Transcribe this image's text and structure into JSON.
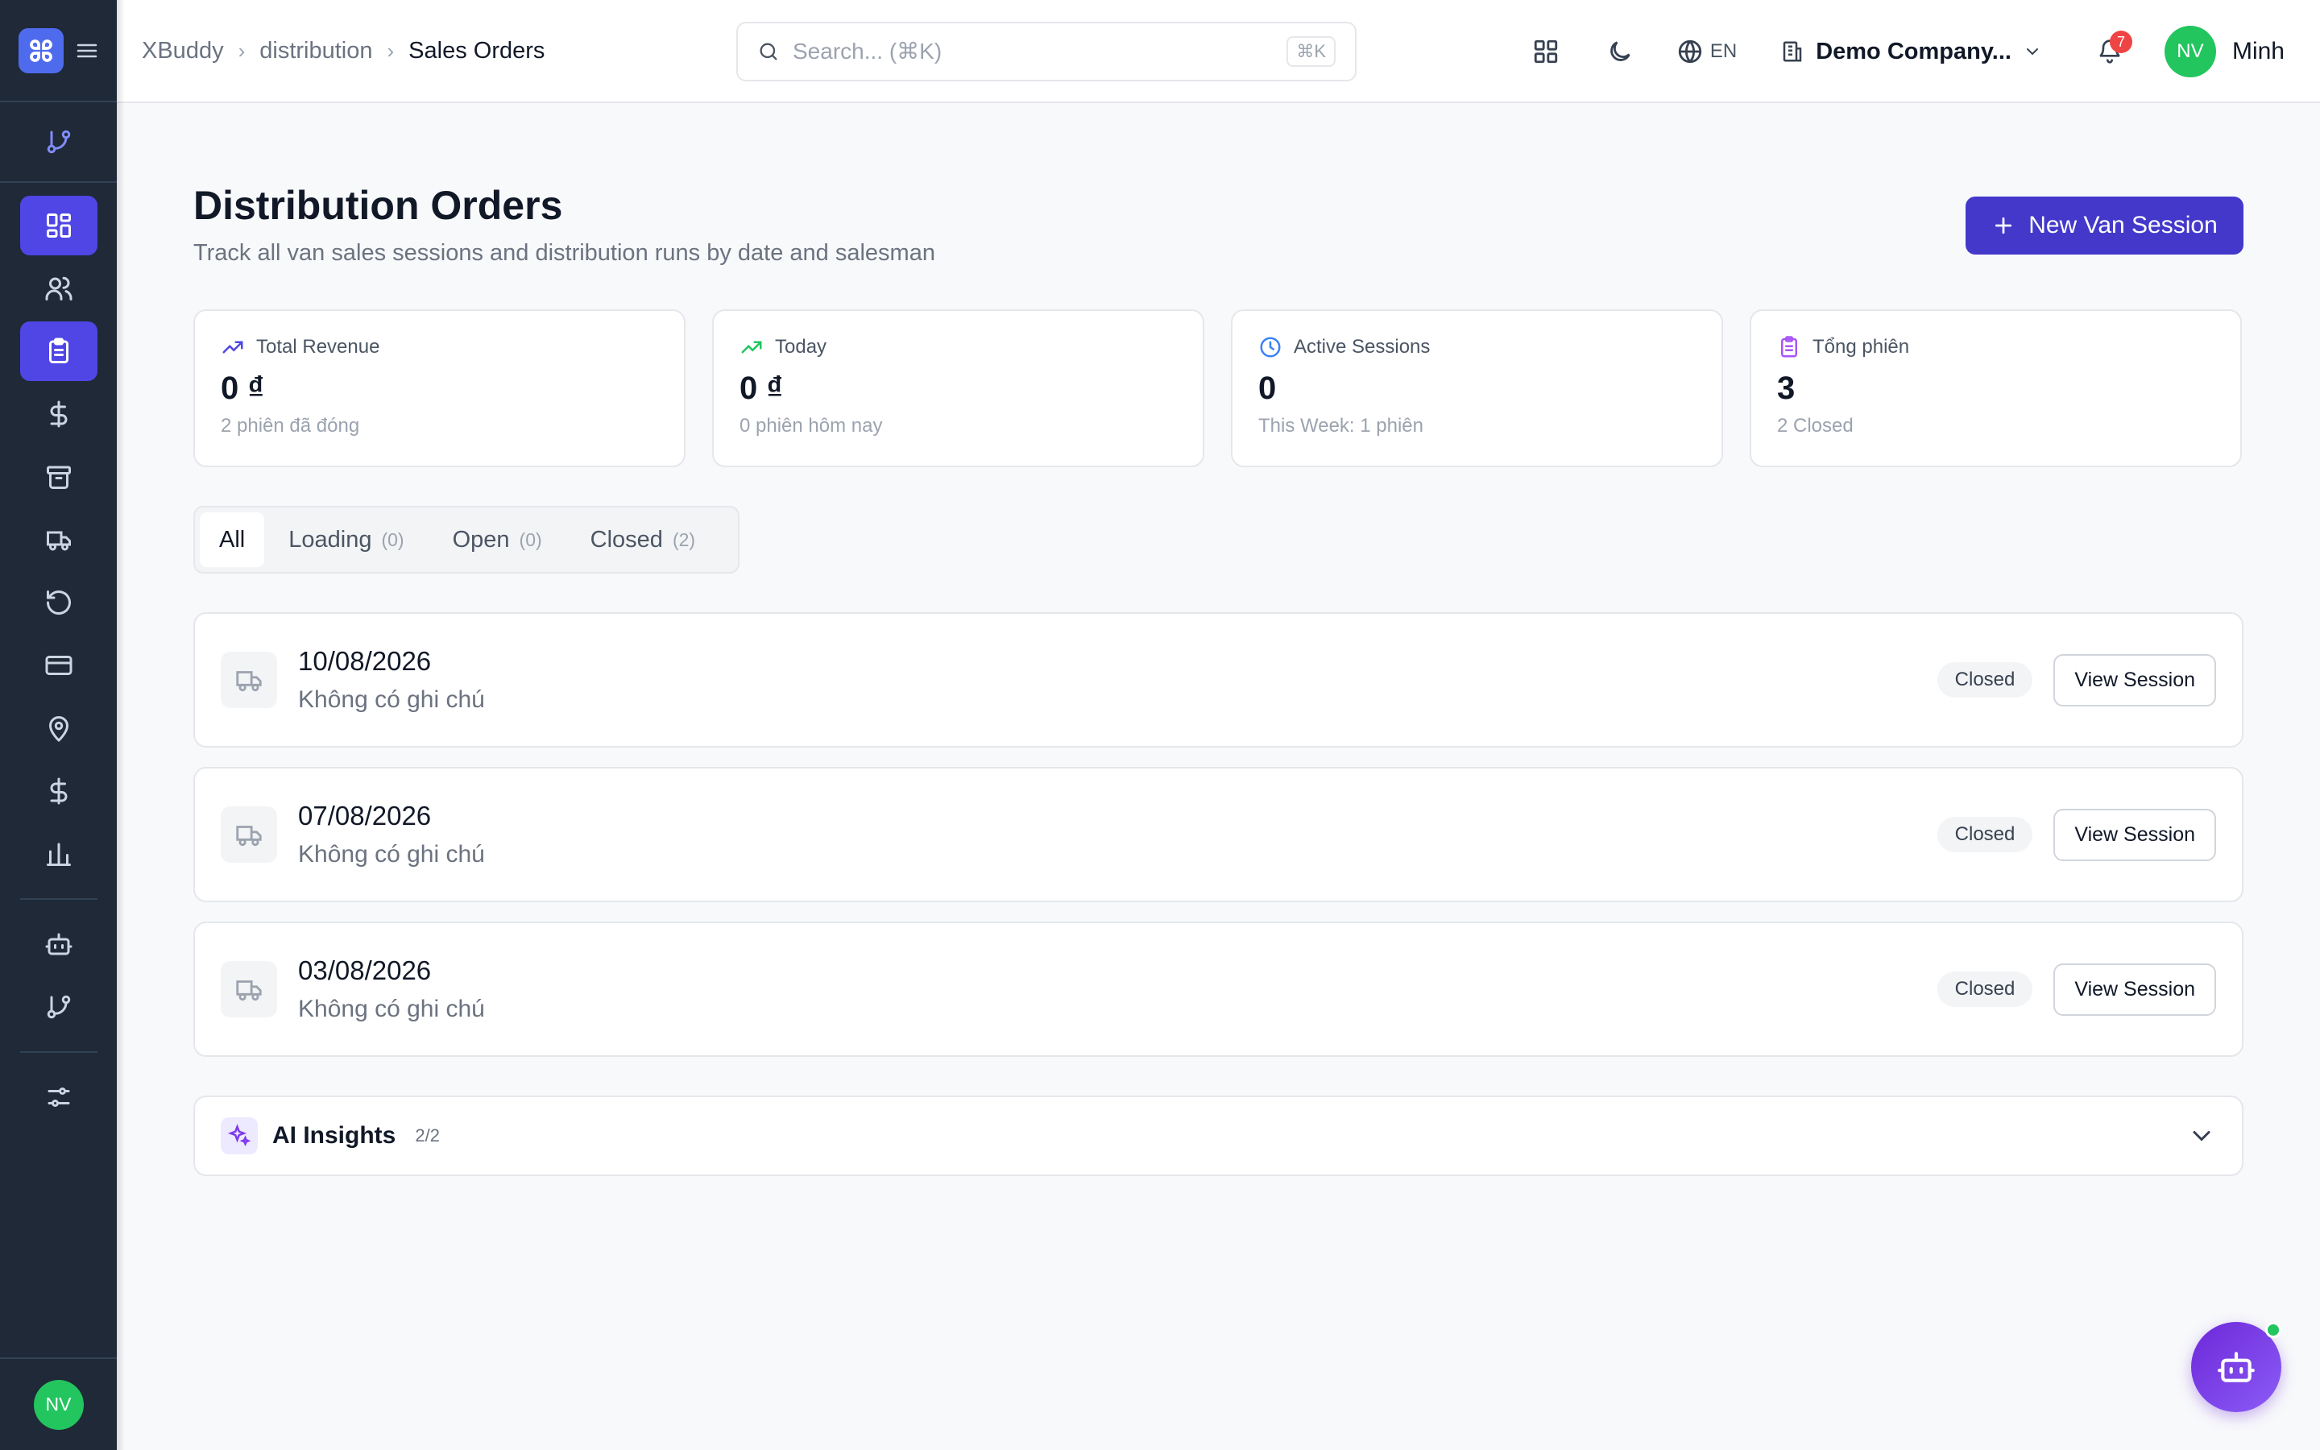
{
  "breadcrumb": {
    "root": "XBuddy",
    "section": "distribution",
    "current": "Sales Orders"
  },
  "search": {
    "placeholder": "Search... (⌘K)",
    "shortcut": "⌘K"
  },
  "topbar": {
    "language": "EN",
    "company": "Demo Company...",
    "notifications": "7",
    "user_initials": "NV",
    "user_name": "Minh"
  },
  "page": {
    "title": "Distribution Orders",
    "subtitle": "Track all van sales sessions and distribution runs by date and salesman",
    "new_button": "New Van Session"
  },
  "stats": [
    {
      "label": "Total Revenue",
      "value": "0 ₫",
      "note": "2 phiên đã đóng",
      "icon": "trending-up-icon",
      "color": "#4f46e5"
    },
    {
      "label": "Today",
      "value": "0 ₫",
      "note": "0 phiên hôm nay",
      "icon": "trending-up-icon",
      "color": "#22c55e"
    },
    {
      "label": "Active Sessions",
      "value": "0",
      "note": "This Week: 1 phiên",
      "icon": "clock-icon",
      "color": "#3b82f6"
    },
    {
      "label": "Tổng phiên",
      "value": "3",
      "note": "2 Closed",
      "icon": "clipboard-icon",
      "color": "#a855f7"
    }
  ],
  "tabs": [
    {
      "label": "All",
      "count": ""
    },
    {
      "label": "Loading",
      "count": "(0)"
    },
    {
      "label": "Open",
      "count": "(0)"
    },
    {
      "label": "Closed",
      "count": "(2)"
    }
  ],
  "sessions": [
    {
      "date": "10/08/2026",
      "note": "Không có ghi chú",
      "status": "Closed",
      "action": "View Session"
    },
    {
      "date": "07/08/2026",
      "note": "Không có ghi chú",
      "status": "Closed",
      "action": "View Session"
    },
    {
      "date": "03/08/2026",
      "note": "Không có ghi chú",
      "status": "Closed",
      "action": "View Session"
    }
  ],
  "insights": {
    "title": "AI Insights",
    "count": "2/2"
  },
  "sidebar": {
    "user_initials": "NV"
  }
}
